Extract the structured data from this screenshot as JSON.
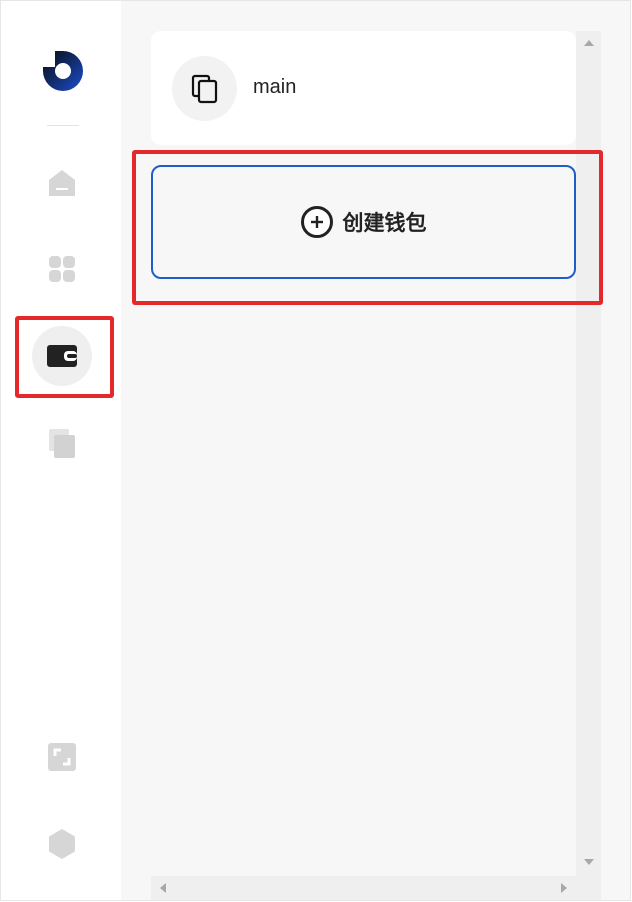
{
  "sidebar": {
    "items": [
      {
        "name": "home",
        "icon": "home-icon"
      },
      {
        "name": "apps",
        "icon": "grid-icon"
      },
      {
        "name": "wallet",
        "icon": "wallet-icon",
        "active": true
      },
      {
        "name": "copy",
        "icon": "copy-icon"
      }
    ],
    "bottom_items": [
      {
        "name": "expand",
        "icon": "expand-icon"
      },
      {
        "name": "settings",
        "icon": "hexagon-icon"
      }
    ]
  },
  "wallets": [
    {
      "name": "main",
      "icon": "copy-icon"
    }
  ],
  "create_wallet": {
    "label": "创建钱包",
    "icon": "plus-circle-icon"
  },
  "colors": {
    "accent": "#1f5ec9",
    "highlight": "#e5282a"
  }
}
